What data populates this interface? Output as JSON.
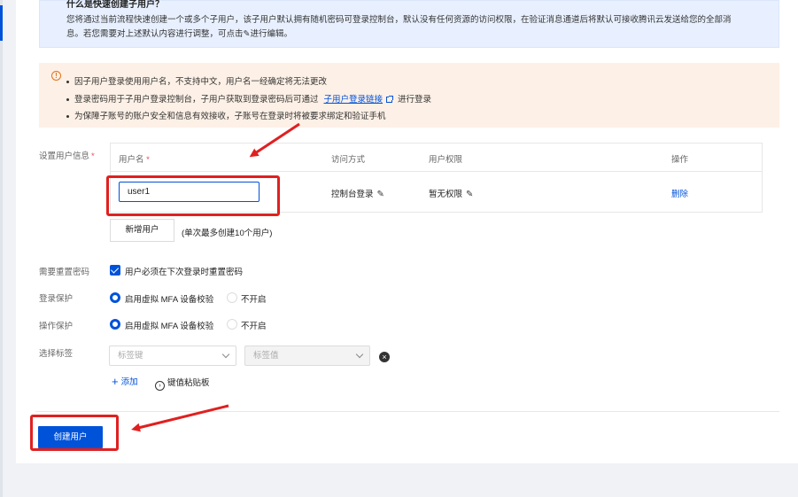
{
  "info": {
    "title": "什么是快速创建子用户？",
    "line1": "您将通过当前流程快速创建一个或多个子用户，该子用户默认拥有随机密码可登录控制台，默认没有任何资源的访问权限，在验证消息通道后将默认可接收腾讯云发送给您的全部消",
    "line2": "息。若您需要对上述默认内容进行调整，可点击",
    "line2_end": "进行编辑。"
  },
  "warning": {
    "line1": "因子用户登录使用用户名，不支持中文，用户名一经确定将无法更改",
    "line2_pre": "登录密码用于子用户登录控制台，子用户获取到登录密码后可通过",
    "line2_link": "子用户登录链接",
    "line2_post": "进行登录",
    "line3": "为保障子账号的账户安全和信息有效接收，子账号在登录时将被要求绑定和验证手机"
  },
  "form": {
    "user_info_label": "设置用户信息",
    "required_mark": "*",
    "reset_pw_label": "需要重置密码",
    "reset_pw_option": "用户必须在下次登录时重置密码",
    "login_protect_label": "登录保护",
    "op_protect_label": "操作保护",
    "mfa_option": "启用虚拟 MFA 设备校验",
    "off_option": "不开启",
    "tag_label": "选择标签",
    "tag_key_placeholder": "标签键",
    "tag_value_placeholder": "标签值",
    "add_tag": "添加",
    "paste_label": "键值粘贴板"
  },
  "table": {
    "headers": [
      "用户名",
      "访问方式",
      "用户权限",
      "操作"
    ],
    "rows": [
      {
        "username": "user1",
        "access": "控制台登录",
        "permission": "暂无权限",
        "action": "删除"
      }
    ]
  },
  "buttons": {
    "add_user": "新增用户",
    "add_user_hint": "(单次最多创建10个用户)",
    "create_user": "创建用户"
  },
  "colors": {
    "primary": "#0052d9",
    "annotation": "#e02020",
    "warning_bg": "#fdf0e6"
  }
}
